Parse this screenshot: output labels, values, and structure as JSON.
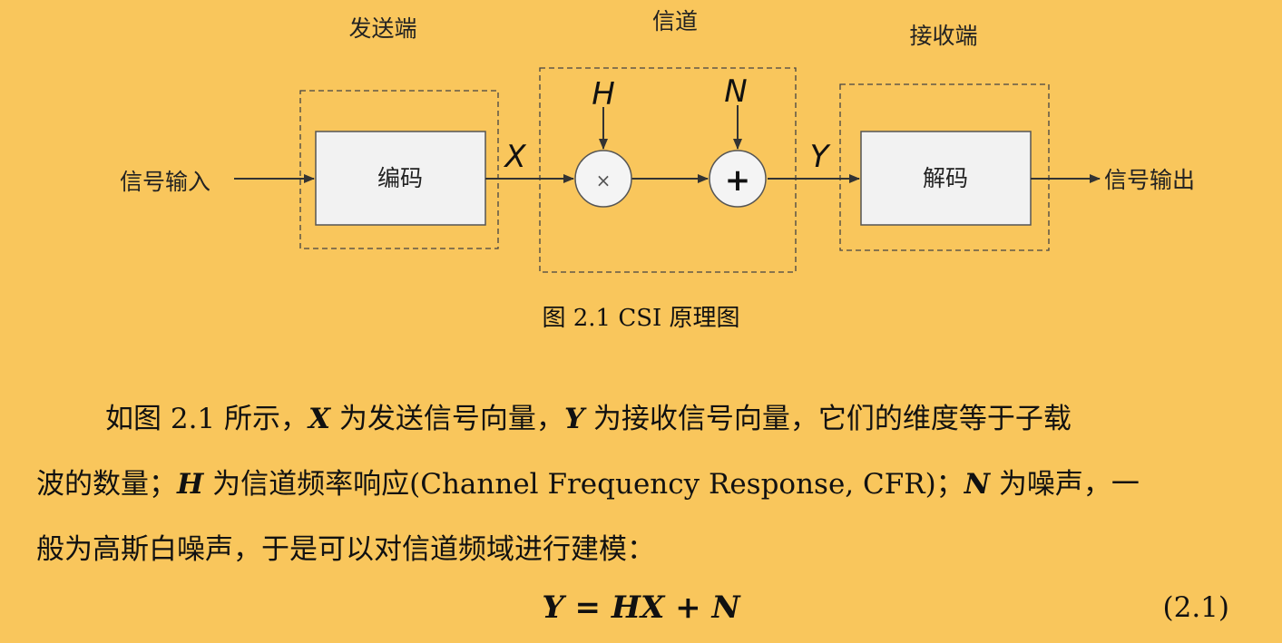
{
  "diagram": {
    "sender_label": "发送端",
    "channel_label": "信道",
    "receiver_label": "接收端",
    "input_label": "信号输入",
    "output_label": "信号输出",
    "encode_label": "编码",
    "decode_label": "解码",
    "sym_x": "X",
    "sym_y": "Y",
    "sym_h": "H",
    "sym_n": "N",
    "multiply_symbol": "×",
    "add_symbol": "+"
  },
  "caption": "图 2.1  CSI 原理图",
  "paragraph": {
    "p1": "如图 2.1 所示，",
    "x": "X",
    "p2": " 为发送信号向量，",
    "y": "Y",
    "p3": " 为接收信号向量，它们的维度等于子载",
    "p4": "波的数量；",
    "h": "H",
    "p5": " 为信道频率响应(Channel Frequency Response, CFR)；",
    "n": "N",
    "p6": " 为噪声，一",
    "p7": "般为高斯白噪声，于是可以对信道频域进行建模："
  },
  "equation": "Y = HX + N",
  "equation_number": "(2.1)"
}
